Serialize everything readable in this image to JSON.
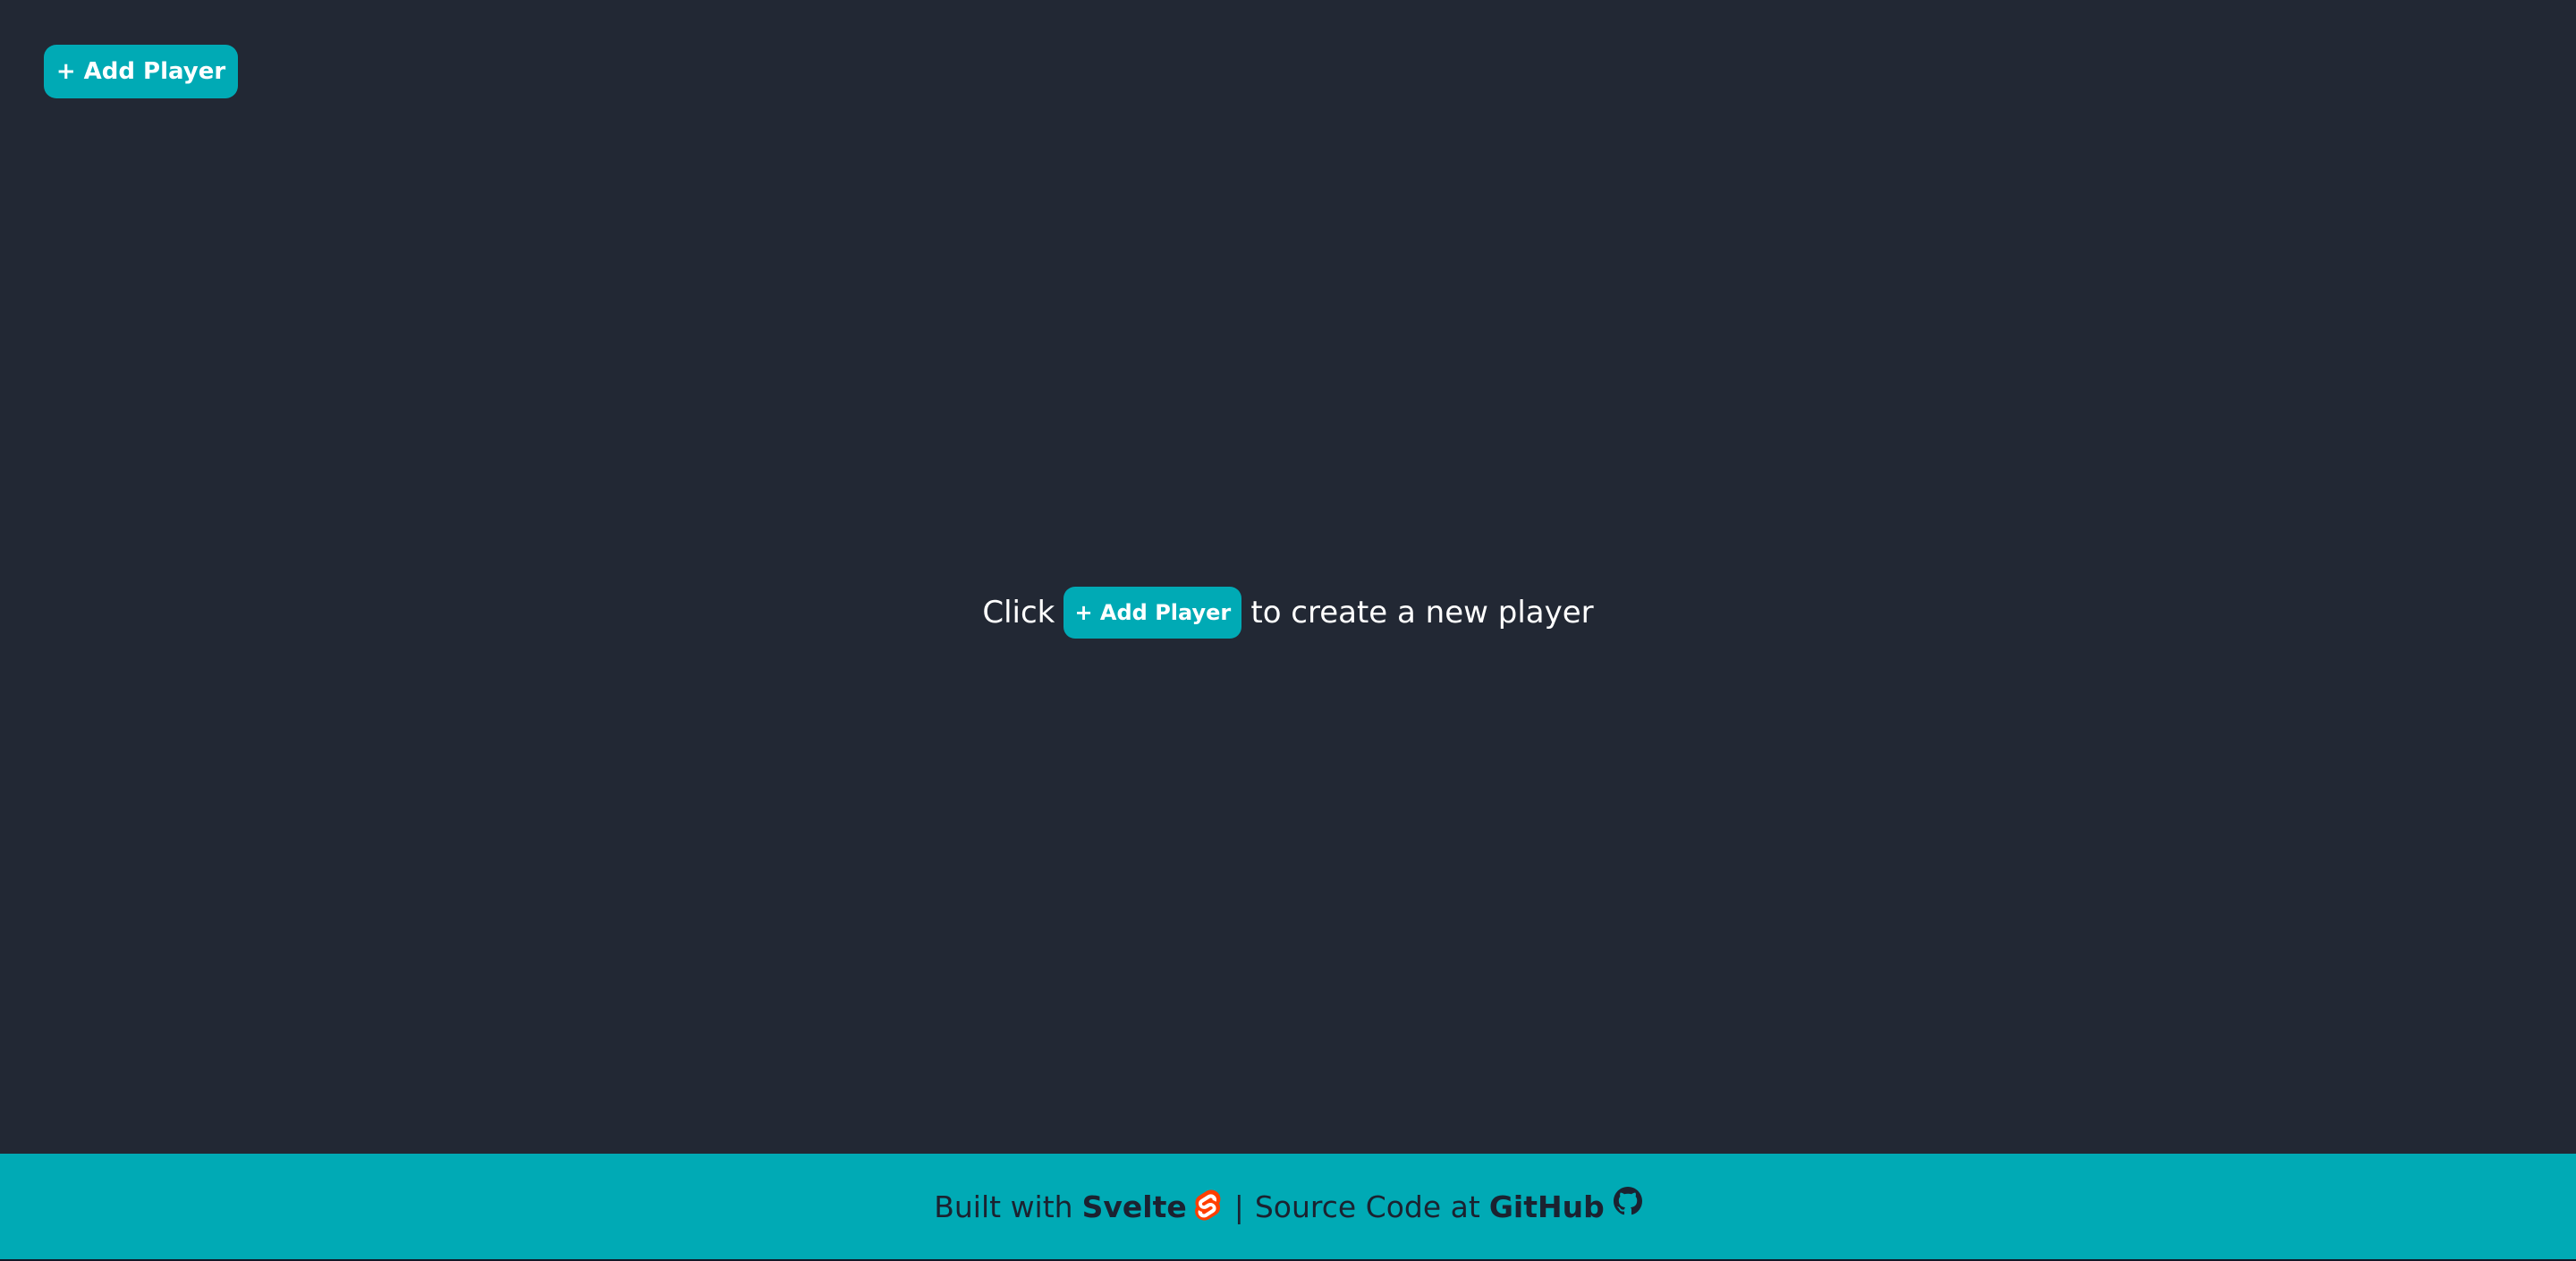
{
  "header": {
    "add_player_label": "+ Add Player"
  },
  "empty_state": {
    "prefix": "Click",
    "button_label": "+ Add Player",
    "suffix": "to create a new player"
  },
  "footer": {
    "built_with": "Built with",
    "svelte_label": "Svelte",
    "divider": "|",
    "source_text": "Source Code at",
    "github_label": "GitHub",
    "svelte_icon": "svelte-icon",
    "github_icon": "github-icon"
  },
  "colors": {
    "background": "#222834",
    "accent": "#00aab5",
    "svelte": "#ff3e00",
    "footer_text": "#1b2230"
  }
}
